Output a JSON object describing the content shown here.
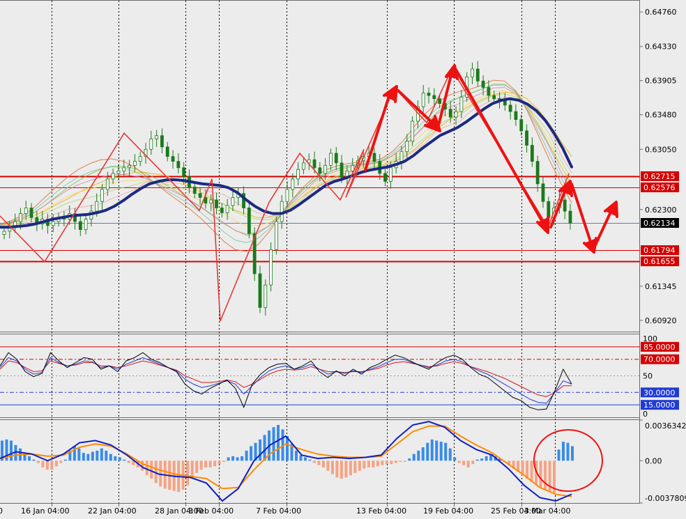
{
  "chart_data": {
    "type": "candlestick",
    "colors": {
      "background": "#ececec",
      "price_line": "#1b2a80",
      "level_line": "#d50000",
      "zigzag": "#e53935",
      "arrows": "#ee1111",
      "hist_positive": "#3a8be6",
      "hist_negative": "#f4a384",
      "macd_line": "#1020c0",
      "signal_line": "#ff8a00",
      "osc_black": "#000000",
      "osc_blue": "#1f3bd6",
      "osc_red": "#d41a1a"
    },
    "x_labels": [
      "16 Jan 04:00",
      "22 Jan 04:00",
      "28 Jan 04:00",
      "3 Feb 04:00",
      "7 Feb 04:00",
      "13 Feb 04:00",
      "19 Feb 04:00",
      "25 Feb 04:00",
      "3 Mar 04:00"
    ],
    "x_label_fragment": "0",
    "price_panel": {
      "ylim": [
        0.6078,
        0.649
      ],
      "ticks": [
        "0.64760",
        "0.64330",
        "0.63905",
        "0.63480",
        "0.63050",
        "0.62300",
        "0.61345",
        "0.60920"
      ],
      "current_price": "0.62134",
      "levels": [
        {
          "label": "0.62715",
          "value": 0.62715
        },
        {
          "label": "0.62576",
          "value": 0.62576
        },
        {
          "label": "0.61794",
          "value": 0.61794
        },
        {
          "label": "0.61655",
          "value": 0.61655
        }
      ],
      "close_series": [
        0.6203,
        0.6208,
        0.6215,
        0.6225,
        0.6232,
        0.622,
        0.6212,
        0.6218,
        0.621,
        0.6215,
        0.622,
        0.6218,
        0.6225,
        0.6215,
        0.6205,
        0.6218,
        0.6228,
        0.624,
        0.6255,
        0.6268,
        0.6275,
        0.6278,
        0.6282,
        0.6285,
        0.629,
        0.6296,
        0.6305,
        0.6318,
        0.6322,
        0.6308,
        0.6296,
        0.629,
        0.6282,
        0.6271,
        0.6258,
        0.625,
        0.6245,
        0.6238,
        0.6242,
        0.6232,
        0.6226,
        0.6235,
        0.6245,
        0.625,
        0.6232,
        0.62,
        0.615,
        0.6108,
        0.6136,
        0.618,
        0.6215,
        0.624,
        0.6255,
        0.6268,
        0.628,
        0.6288,
        0.6292,
        0.6282,
        0.6275,
        0.6285,
        0.63,
        0.6288,
        0.627,
        0.6278,
        0.6285,
        0.6291,
        0.6296,
        0.63,
        0.629,
        0.6275,
        0.6265,
        0.6282,
        0.629,
        0.6302,
        0.6315,
        0.634,
        0.6358,
        0.6375,
        0.6372,
        0.6368,
        0.6362,
        0.6355,
        0.6345,
        0.6352,
        0.637,
        0.6395,
        0.6405,
        0.639,
        0.6382,
        0.6372,
        0.6368,
        0.6365,
        0.636,
        0.6352,
        0.6342,
        0.6328,
        0.631,
        0.629,
        0.6262,
        0.624,
        0.622,
        0.6232,
        0.6242,
        0.6228,
        0.6213
      ],
      "ma_series": [
        {
          "name": "thick",
          "values": [
            0.6208,
            0.6208,
            0.6209,
            0.621,
            0.6212,
            0.6215,
            0.6218,
            0.622,
            0.6222,
            0.6223,
            0.6224,
            0.6226,
            0.6229,
            0.6234,
            0.6241,
            0.6249,
            0.6256,
            0.6262,
            0.6265,
            0.6267,
            0.6267,
            0.6266,
            0.6264,
            0.6262,
            0.6261,
            0.626,
            0.6257,
            0.6251,
            0.6242,
            0.6234,
            0.6228,
            0.6225,
            0.6225,
            0.6229,
            0.6236,
            0.6244,
            0.6252,
            0.626,
            0.6265,
            0.6268,
            0.6272,
            0.6276,
            0.6279,
            0.6281,
            0.6283,
            0.6286,
            0.629,
            0.6297,
            0.6306,
            0.6314,
            0.6322,
            0.6327,
            0.6332,
            0.6339,
            0.6347,
            0.6355,
            0.6362,
            0.6366,
            0.6368,
            0.6366,
            0.6361,
            0.6353,
            0.6341,
            0.6325,
            0.6306,
            0.6283
          ]
        },
        {
          "name": "ma_1",
          "values": [
            0.621,
            0.6213,
            0.6217,
            0.6222,
            0.6228,
            0.6236,
            0.6243,
            0.6251,
            0.6258,
            0.6264,
            0.627,
            0.6274,
            0.6276,
            0.6276,
            0.6274,
            0.6271,
            0.6266,
            0.6259,
            0.6251,
            0.6243,
            0.6236,
            0.6229,
            0.6224,
            0.622,
            0.622,
            0.6225,
            0.6235,
            0.6246,
            0.6256,
            0.6264,
            0.627,
            0.6276,
            0.628,
            0.6282,
            0.6285,
            0.6289,
            0.6296,
            0.6305,
            0.6318,
            0.633,
            0.6341,
            0.6352,
            0.636,
            0.6367,
            0.6373,
            0.6376,
            0.6375,
            0.6368,
            0.6355,
            0.6337,
            0.6316,
            0.6296
          ]
        },
        {
          "name": "ma_2",
          "values": [
            0.6211,
            0.6214,
            0.6219,
            0.6226,
            0.6235,
            0.6246,
            0.6257,
            0.6266,
            0.6274,
            0.628,
            0.6284,
            0.6284,
            0.6281,
            0.6275,
            0.6268,
            0.6259,
            0.625,
            0.6241,
            0.6232,
            0.6222,
            0.6212,
            0.6204,
            0.6198,
            0.62,
            0.621,
            0.6226,
            0.6241,
            0.6255,
            0.6266,
            0.6274,
            0.628,
            0.6284,
            0.6286,
            0.6287,
            0.629,
            0.6297,
            0.6308,
            0.6322,
            0.6337,
            0.6351,
            0.6362,
            0.637,
            0.6375,
            0.638,
            0.6385,
            0.6385,
            0.6377,
            0.636,
            0.6336,
            0.631,
            0.6285,
            0.6262
          ]
        },
        {
          "name": "ma_3",
          "values": [
            0.6212,
            0.6216,
            0.6223,
            0.6232,
            0.6245,
            0.6258,
            0.627,
            0.628,
            0.6287,
            0.6292,
            0.6293,
            0.629,
            0.6283,
            0.6272,
            0.6261,
            0.625,
            0.624,
            0.623,
            0.6218,
            0.6204,
            0.619,
            0.618,
            0.6178,
            0.6186,
            0.6202,
            0.6222,
            0.6241,
            0.6257,
            0.627,
            0.6279,
            0.6284,
            0.6287,
            0.6289,
            0.629,
            0.6293,
            0.6302,
            0.6316,
            0.6334,
            0.635,
            0.6363,
            0.6372,
            0.6377,
            0.638,
            0.6385,
            0.6391,
            0.639,
            0.6378,
            0.6354,
            0.6323,
            0.6292,
            0.6264,
            0.6238
          ]
        }
      ],
      "zigzag": [
        0.6222,
        0.6165,
        0.6325,
        0.6229,
        0.6268,
        0.6091,
        0.6239,
        0.63,
        0.6242,
        0.6305,
        0.6245,
        0.6382,
        0.6338,
        0.6405,
        0.6208,
        0.6275
      ]
    },
    "oscillator_panel": {
      "ylim": [
        0,
        100
      ],
      "ticks": [
        "100",
        "50",
        "0"
      ],
      "levels": [
        {
          "label": "85.0000",
          "value": 85
        },
        {
          "label": "70.0000",
          "value": 70
        },
        {
          "label": "30.0000",
          "value": 30
        },
        {
          "label": "15.0000",
          "value": 15
        }
      ],
      "series": [
        {
          "name": "black",
          "values": [
            62,
            78,
            70,
            55,
            49,
            53,
            78,
            68,
            60,
            66,
            72,
            70,
            58,
            62,
            55,
            68,
            72,
            78,
            70,
            66,
            60,
            55,
            40,
            32,
            28,
            35,
            40,
            45,
            35,
            12,
            40,
            52,
            60,
            64,
            65,
            58,
            62,
            68,
            55,
            48,
            56,
            50,
            58,
            52,
            60,
            64,
            70,
            75,
            72,
            67,
            62,
            58,
            66,
            72,
            75,
            70,
            60,
            52,
            48,
            40,
            32,
            24,
            20,
            12,
            9,
            10,
            32,
            58,
            40
          ]
        },
        {
          "name": "blue",
          "values": [
            60,
            72,
            68,
            58,
            52,
            54,
            72,
            66,
            62,
            64,
            68,
            67,
            60,
            62,
            58,
            64,
            68,
            72,
            68,
            64,
            60,
            56,
            46,
            40,
            36,
            38,
            41,
            44,
            40,
            28,
            38,
            48,
            56,
            60,
            62,
            58,
            60,
            64,
            58,
            52,
            55,
            53,
            56,
            54,
            58,
            61,
            66,
            70,
            70,
            66,
            63,
            60,
            63,
            68,
            70,
            67,
            61,
            56,
            52,
            46,
            40,
            34,
            28,
            22,
            18,
            17,
            30,
            44,
            40
          ]
        },
        {
          "name": "red",
          "values": [
            58,
            68,
            66,
            60,
            55,
            56,
            68,
            65,
            62,
            63,
            66,
            66,
            62,
            62,
            60,
            62,
            65,
            68,
            66,
            63,
            60,
            57,
            50,
            46,
            42,
            42,
            43,
            45,
            43,
            36,
            40,
            46,
            52,
            56,
            58,
            57,
            58,
            61,
            58,
            55,
            55,
            54,
            55,
            55,
            57,
            59,
            63,
            66,
            67,
            65,
            63,
            61,
            62,
            65,
            67,
            65,
            61,
            58,
            55,
            51,
            47,
            42,
            37,
            32,
            27,
            25,
            30,
            38,
            38
          ]
        }
      ]
    },
    "macd_panel": {
      "ylim": [
        -0.0037809,
        0.0036342
      ],
      "ticks": [
        "0.0036342",
        "0.00",
        "-0.0037809"
      ],
      "histogram": [
        0.0018,
        0.0019,
        0.0018,
        0.0014,
        0.0011,
        0.0007,
        0.0004,
        0.0001,
        -0.0002,
        -0.0006,
        -0.0008,
        -0.0008,
        -0.0005,
        -0.0002,
        0.0001,
        0.0009,
        0.0013,
        0.0011,
        0.0007,
        0.0006,
        0.0008,
        0.0009,
        0.0011,
        0.0009,
        0.0006,
        0.0004,
        0.0003,
        0.0001,
        -0.0002,
        -0.0004,
        -0.0006,
        -0.0009,
        -0.0013,
        -0.0016,
        -0.002,
        -0.0023,
        -0.0025,
        -0.0026,
        -0.0027,
        -0.0028,
        -0.0026,
        -0.0022,
        -0.0016,
        -0.0011,
        -0.0008,
        -0.0006,
        -0.0006,
        -0.0005,
        -0.0003,
        -0.0001,
        0.0003,
        0.0004,
        0.0003,
        0.0004,
        0.0009,
        0.0013,
        0.0016,
        0.0019,
        0.0023,
        0.0027,
        0.003,
        0.0032,
        0.0028,
        0.0022,
        0.0015,
        0.0009,
        0.0005,
        0.0003,
        0.0001,
        -0.0002,
        -0.0004,
        -0.0006,
        -0.0009,
        -0.0012,
        -0.0015,
        -0.0016,
        -0.0015,
        -0.0013,
        -0.0011,
        -0.0009,
        -0.0007,
        -0.0006,
        -0.0006,
        -0.0005,
        -0.0004,
        -0.0003,
        -0.0003,
        -0.0002,
        -0.0001,
        -0.0001,
        0.0002,
        0.0006,
        0.0009,
        0.0012,
        0.0016,
        0.0019,
        0.0018,
        0.0017,
        0.0016,
        0.0011,
        0.0003,
        -0.0002,
        -0.0004,
        -0.0006,
        -0.0003,
        0.0001,
        0.0002,
        0.0004,
        0.0006,
        0.0004,
        0.0002,
        -0.0001,
        -0.0004,
        -0.0007,
        -0.001,
        -0.0013,
        -0.0016,
        -0.0019,
        -0.0021,
        -0.0024,
        -0.0026,
        -0.0028,
        -0.003,
        0.001,
        0.0017,
        0.0016,
        0.0013
      ],
      "macd": [
        0.0002,
        0.0008,
        0.0006,
        0.0,
        0.0006,
        0.0016,
        0.0018,
        0.0014,
        0.0005,
        -0.0006,
        -0.0012,
        -0.0014,
        -0.0015,
        -0.002,
        -0.0036,
        -0.0025,
        0.0,
        0.0014,
        0.0022,
        0.0005,
        0.0002,
        0.0003,
        0.0002,
        0.0003,
        0.0005,
        0.002,
        0.0032,
        0.0035,
        0.003,
        0.0018,
        0.001,
        0.0005,
        -0.0007,
        -0.0022,
        -0.0033,
        -0.0036,
        -0.003
      ],
      "signal": [
        0.0002,
        0.0005,
        0.0006,
        0.0004,
        0.0005,
        0.0012,
        0.0015,
        0.0013,
        0.0006,
        -0.0003,
        -0.0008,
        -0.0012,
        -0.0014,
        -0.0016,
        -0.0025,
        -0.0024,
        -0.0008,
        0.0006,
        0.0015,
        0.001,
        0.0006,
        0.0004,
        0.0003,
        0.0003,
        0.0004,
        0.0015,
        0.0026,
        0.0031,
        0.0031,
        0.0022,
        0.0014,
        0.0007,
        -0.0003,
        -0.0013,
        -0.0024,
        -0.003,
        -0.0032
      ]
    }
  }
}
